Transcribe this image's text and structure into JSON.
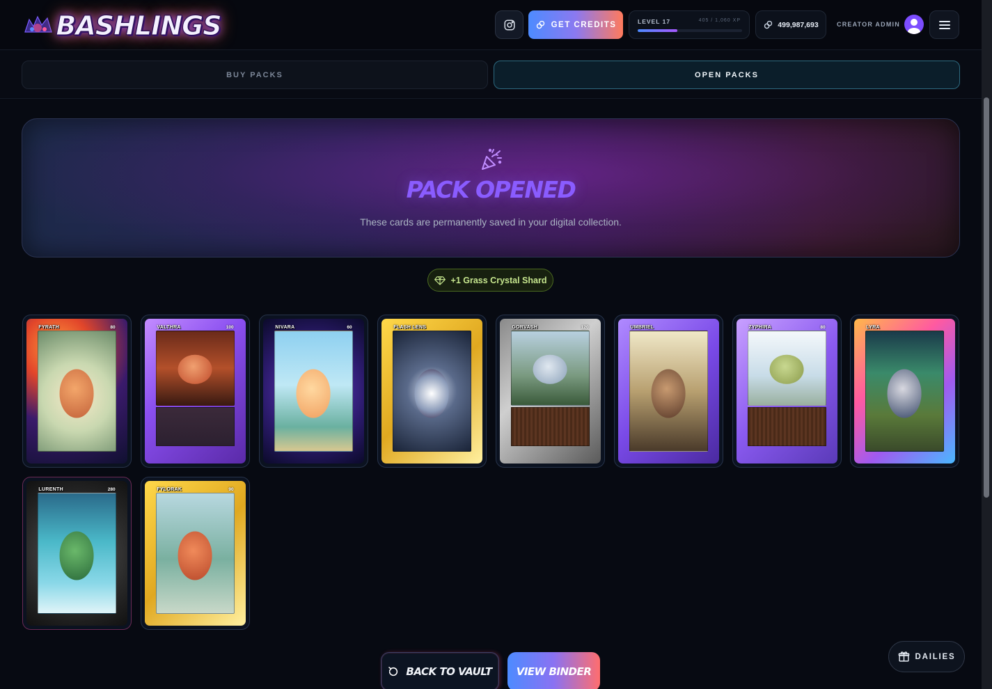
{
  "header": {
    "logo_text": "BASHLINGS",
    "credits_label": "GET CREDITS",
    "level_label": "LEVEL 17",
    "xp_text": "405 / 1,060 XP",
    "xp_progress": 0.38,
    "coins": "499,987,693",
    "user_label": "CREATOR ADMIN"
  },
  "tabs": [
    {
      "label": "BUY PACKS",
      "active": false
    },
    {
      "label": "OPEN PACKS",
      "active": true
    }
  ],
  "hero": {
    "title": "PACK OPENED",
    "subtitle": "These cards are permanently saved in your digital collection."
  },
  "reward": {
    "label": "+1 Grass Crystal Shard"
  },
  "cards": [
    {
      "name": "FYRATH",
      "hp": "80"
    },
    {
      "name": "VALTHRA",
      "hp": "100"
    },
    {
      "name": "NIVARA",
      "hp": "60"
    },
    {
      "name": "FLASH LENS",
      "hp": ""
    },
    {
      "name": "GORVASH",
      "hp": "120"
    },
    {
      "name": "UMBRIEL",
      "hp": ""
    },
    {
      "name": "ZYPHIRA",
      "hp": "80"
    },
    {
      "name": "LYRA",
      "hp": ""
    },
    {
      "name": "LURENTH",
      "hp": "280"
    },
    {
      "name": "FYLORAK",
      "hp": "90"
    }
  ],
  "actions": {
    "back_label": "BACK TO VAULT",
    "binder_label": "VIEW BINDER",
    "dailies_label": "DAILIES"
  },
  "colors": {
    "accent_purple": "#8a5cff",
    "reward_green": "#c6e68e",
    "tab_active_border": "#2d6a80"
  },
  "icons": {
    "instagram": "instagram-icon",
    "credits": "link-coin-icon",
    "coins": "link-coin-icon",
    "menu": "hamburger-menu-icon",
    "celebration": "party-popper-icon",
    "reward": "gem-icon",
    "back": "refresh-icon",
    "dailies": "gift-icon"
  }
}
